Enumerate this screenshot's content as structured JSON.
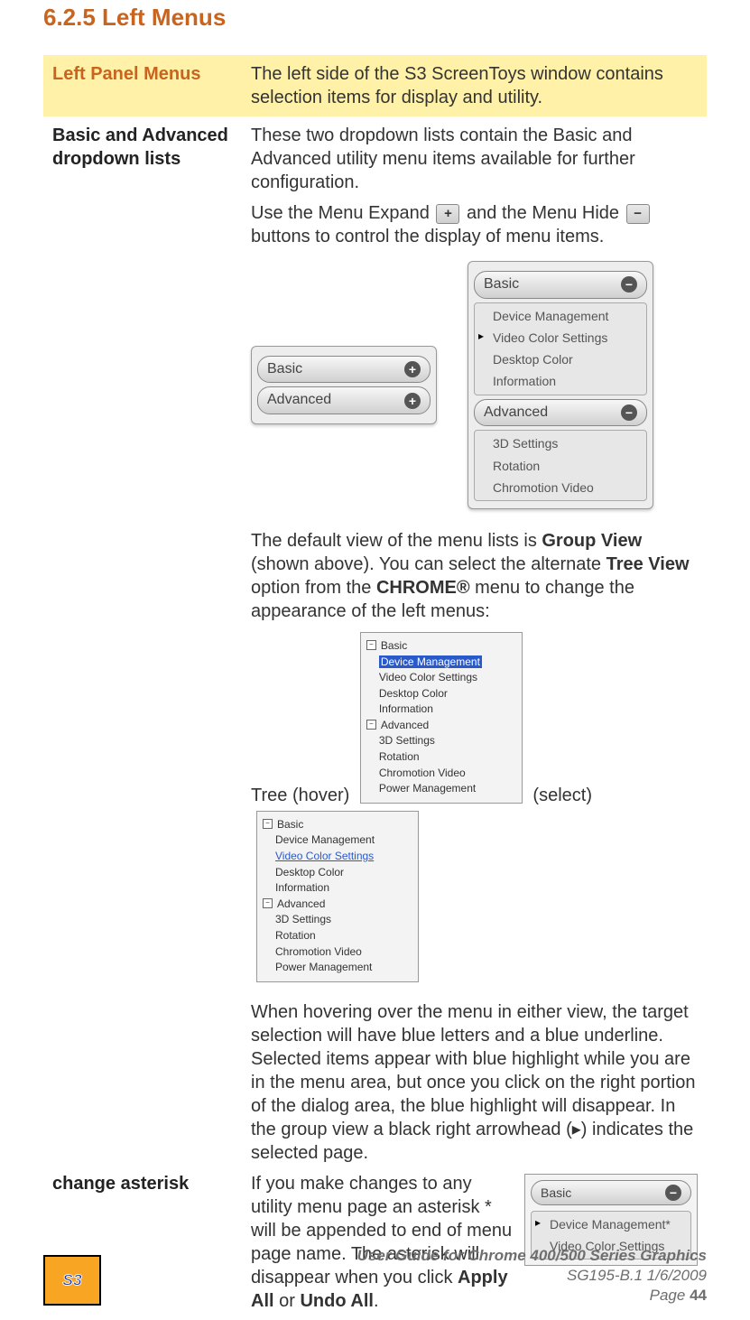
{
  "heading": "6.2.5 Left Menus",
  "rows": {
    "left_panel": {
      "label": "Left Panel Menus",
      "text": "The left side of the S3 ScreenToys window contains selection items for display and utility."
    },
    "dropdowns": {
      "label": "Basic and Advanced dropdown lists",
      "p1a": "These two dropdown lists contain the Basic and Advanced utility menu items available for further configuration.",
      "p1b_pre": "Use the Menu Expand ",
      "p1b_mid": "and the Menu Hide ",
      "p1b_post": " buttons to control the display of menu items.",
      "p2_a": "The default view of the menu lists is ",
      "p2_b": "Group View",
      "p2_c": " (shown above). You can select the alternate ",
      "p2_d": "Tree View",
      "p2_e": " option from the ",
      "p2_f": "CHROME®",
      "p2_g": " menu to change the appearance of the left menus:",
      "tree_hover_label": "Tree (hover) ",
      "tree_select_label": " (select) ",
      "p3": "When hovering over the menu in either view, the target selection will have blue letters and a blue underline. Selected items appear with blue highlight while you are in the menu area, but once you click on the right portion of the dialog area, the blue highlight will disappear. In the group view a black right arrowhead (▸) indicates the selected page."
    },
    "asterisk": {
      "label": "change asterisk",
      "text_a": "If you make changes to any utility menu page an asterisk * will be appended to end of menu page name. The asterisk will disappear when you click ",
      "apply": "Apply All",
      "or": " or ",
      "undo": "Undo All",
      "dot": "."
    }
  },
  "ui_mock": {
    "pill_basic": "Basic",
    "pill_advanced": "Advanced",
    "plus": "+",
    "minus": "−",
    "basic_items": [
      "Device Management",
      "Video Color Settings",
      "Desktop Color",
      "Information"
    ],
    "advanced_items": [
      "3D Settings",
      "Rotation",
      "Chromotion Video"
    ],
    "tree_basic": "Basic",
    "tree_advanced": "Advanced",
    "tree_basic_items": [
      "Device Management",
      "Video Color Settings",
      "Desktop Color",
      "Information"
    ],
    "tree_adv_items": [
      "3D Settings",
      "Rotation",
      "Chromotion Video",
      "Power Management"
    ],
    "asterisk_item_basic": "Basic",
    "asterisk_item_sel": "Device Management*",
    "asterisk_item_next": "Video Color Settings"
  },
  "footer": {
    "title": "User Guide for Chrome 400/500 Series Graphics",
    "rev": "SG195-B.1   1/6/2009",
    "page_label": "Page ",
    "page_num": "44"
  }
}
